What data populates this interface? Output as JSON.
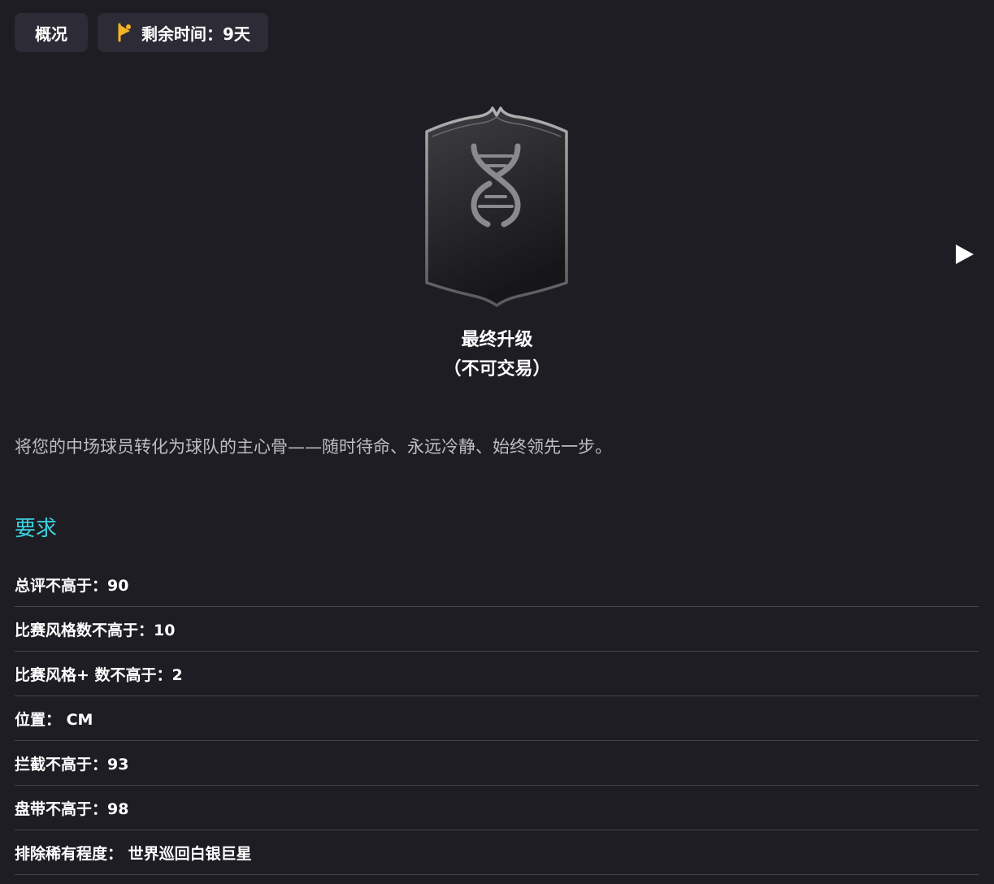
{
  "tabs": {
    "overview_label": "概况",
    "timer_label": "剩余时间：9天",
    "timer_icon": "flag-icon",
    "timer_icon_color": "#f5b324"
  },
  "badge": {
    "icon": "dna-shield-icon"
  },
  "navigation": {
    "next_icon": "play-arrow-icon"
  },
  "upgrade": {
    "title": "最终升级",
    "subtitle": "（不可交易）"
  },
  "description": "将您的中场球员转化为球队的主心骨——随时待命、永远冷静、始终领先一步。",
  "requirements": {
    "heading": "要求",
    "heading_color": "#3bd1e0",
    "items": [
      "总评不高于：90",
      "比赛风格数不高于：10",
      "比赛风格+ 数不高于：2",
      "位置： CM",
      "拦截不高于：93",
      "盘带不高于：98",
      "排除稀有程度： 世界巡回白银巨星"
    ]
  },
  "colors": {
    "background": "#1e1d23",
    "pill_background": "#2d2c36",
    "divider": "#45444e",
    "description_text": "#bcbcc2"
  }
}
